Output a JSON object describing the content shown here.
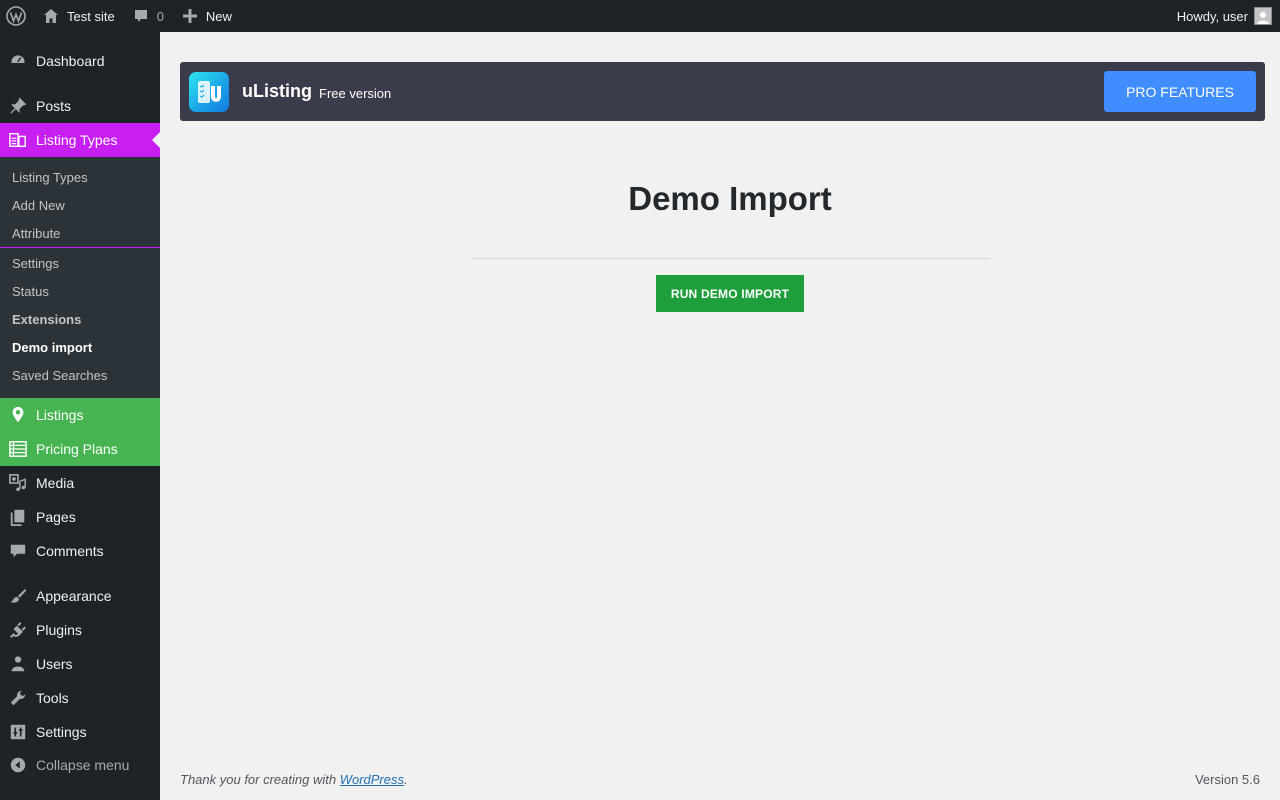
{
  "adminbar": {
    "site_name": "Test site",
    "comments_count": "0",
    "new_label": "New",
    "howdy": "Howdy, user"
  },
  "sidebar": {
    "dashboard": "Dashboard",
    "posts": "Posts",
    "listing_types": "Listing Types",
    "submenu": [
      "Listing Types",
      "Add New",
      "Attribute",
      "Settings",
      "Status",
      "Extensions",
      "Demo import",
      "Saved Searches"
    ],
    "listings": "Listings",
    "pricing_plans": "Pricing Plans",
    "media": "Media",
    "pages": "Pages",
    "comments": "Comments",
    "appearance": "Appearance",
    "plugins": "Plugins",
    "users": "Users",
    "tools": "Tools",
    "settings": "Settings",
    "collapse": "Collapse menu"
  },
  "banner": {
    "brand": "uListing",
    "edition": "Free version",
    "pro_button": "PRO FEATURES"
  },
  "main": {
    "title": "Demo Import",
    "run_button": "RUN DEMO IMPORT"
  },
  "footer": {
    "thanks_prefix": "Thank you for creating with ",
    "thanks_link": "WordPress",
    "thanks_suffix": ".",
    "version": "Version 5.6"
  },
  "colors": {
    "adminbar_bg": "#1d2327",
    "active_menu": "#c71ef2",
    "green_menu": "#46b450",
    "banner_bg": "#3a3b4b",
    "pro_button": "#3f8dff",
    "run_button": "#1f9f3c"
  },
  "icons": [
    "wordpress-logo-icon",
    "home-icon",
    "comment-bubble-icon",
    "plus-icon",
    "avatar-icon",
    "dashboard-icon",
    "pin-icon",
    "listing-types-icon",
    "location-pin-icon",
    "table-list-icon",
    "media-icon",
    "pages-icon",
    "comments-icon",
    "paintbrush-icon",
    "plugin-icon",
    "user-icon",
    "wrench-icon",
    "sliders-icon",
    "collapse-arrow-icon"
  ]
}
